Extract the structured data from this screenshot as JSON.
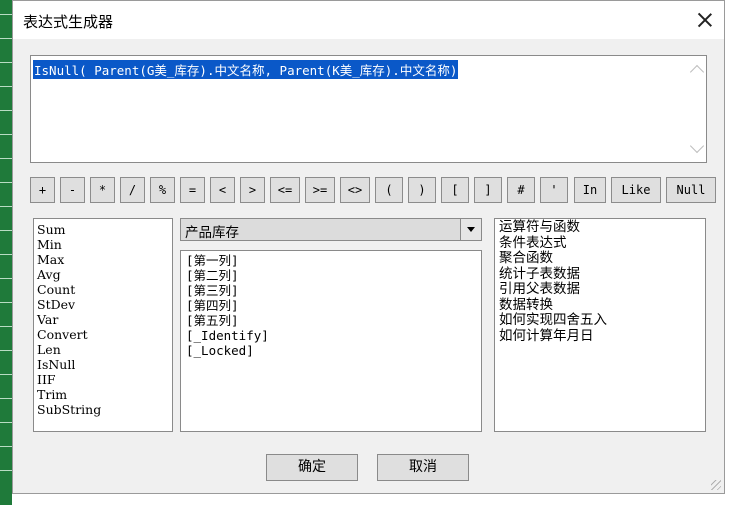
{
  "window": {
    "title": "表达式生成器"
  },
  "expression": {
    "text": "IsNull( Parent(G美_库存).中文名称, Parent(K美_库存).中文名称)"
  },
  "operators": [
    "+",
    "-",
    "*",
    "/",
    "%",
    "=",
    "<",
    ">",
    "<=",
    ">=",
    "<>",
    "(",
    ")",
    "[",
    "]",
    "#",
    "'",
    "In",
    "Like",
    "Null"
  ],
  "functions": [
    "Sum",
    "Min",
    "Max",
    "Avg",
    "Count",
    "StDev",
    "Var",
    "Convert",
    "Len",
    "IsNull",
    "IIF",
    "Trim",
    "SubString"
  ],
  "table_select": {
    "value": "产品库存"
  },
  "fields": [
    "[第一列]",
    "[第二列]",
    "[第三列]",
    "[第四列]",
    "[第五列]",
    "[_Identify]",
    "[_Locked]"
  ],
  "categories": [
    "运算符与函数",
    "条件表达式",
    "聚合函数",
    "统计子表数据",
    "引用父表数据",
    "数据转换",
    "如何实现四舍五入",
    "如何计算年月日"
  ],
  "buttons": {
    "ok": "确定",
    "cancel": "取消"
  },
  "colors": {
    "selection": "#0a58c8",
    "excel_green": "#1f7a3a"
  }
}
